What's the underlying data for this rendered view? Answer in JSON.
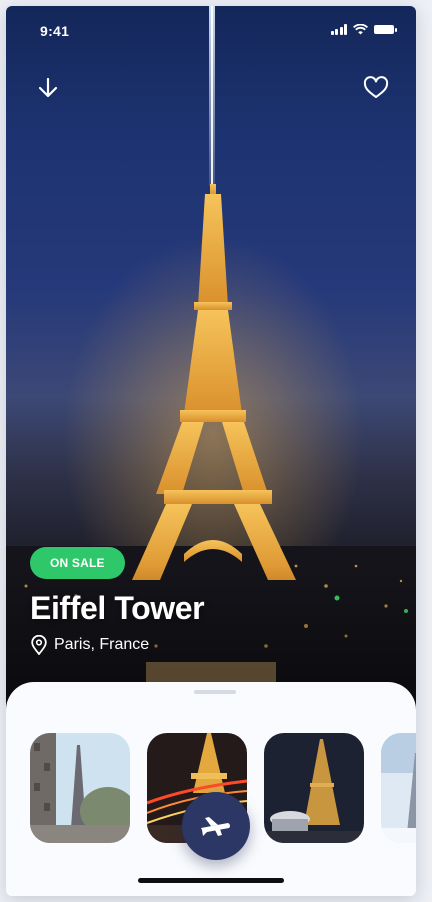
{
  "status_bar": {
    "time": "9:41"
  },
  "hero": {
    "badge": "ON SALE",
    "title": "Eiffel Tower",
    "location": "Paris, France"
  },
  "icons": {
    "back": "arrow-down-icon",
    "favorite": "heart-icon",
    "location": "map-pin-icon",
    "book": "airplane-icon"
  },
  "gallery": {
    "thumbnails": [
      {
        "name": "eiffel-tower-daylight"
      },
      {
        "name": "eiffel-tower-night-traffic"
      },
      {
        "name": "eiffel-tower-carousel"
      },
      {
        "name": "eiffel-tower-snow"
      }
    ]
  },
  "colors": {
    "badge": "#2ec86b",
    "fab": "#2c3766",
    "sheet": "#fafbfe"
  }
}
